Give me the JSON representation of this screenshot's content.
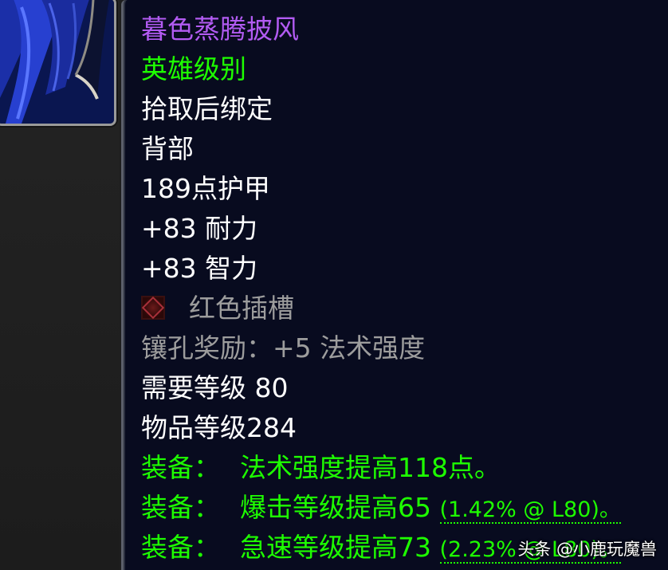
{
  "item": {
    "name": "暮色蒸腾披风",
    "quality": "英雄级别",
    "binding": "拾取后绑定",
    "slot": "背部",
    "armor": "189点护甲",
    "stat1": "+83 耐力",
    "stat2": "+83 智力",
    "socket": "红色插槽",
    "socket_bonus": "镶孔奖励：+5 法术强度",
    "required_level": "需要等级 80",
    "item_level": "物品等级284",
    "equip_label": "装备：",
    "equip1": "法术强度提高118点。",
    "equip2": "爆击等级提高65",
    "equip2_rating": "(1.42% @ L80)。",
    "equip3": "急速等级提高73",
    "equip3_rating": "(2.23% @ L80)。"
  },
  "watermark": "头条 @小鹿玩魔兽",
  "colors": {
    "epic": "#b25bf2",
    "uncommon": "#1eff00",
    "white": "#ffffff",
    "gray": "#9d9d9d",
    "tooltip_bg": "#080b1f"
  },
  "icons": {
    "item": "cloak-icon",
    "socket": "red-socket-icon"
  }
}
